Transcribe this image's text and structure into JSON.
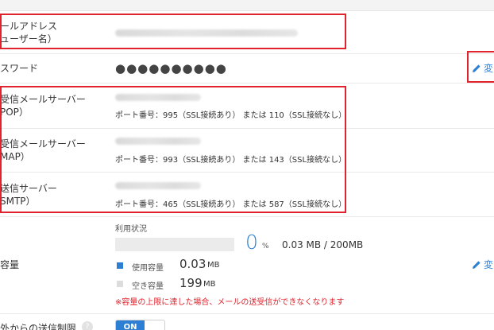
{
  "rows": {
    "email": {
      "label_line1": "ールアドレス",
      "label_line2": "ューザー名）"
    },
    "password": {
      "label": "スワード",
      "masked": "●●●●●●●●●●",
      "edit_label": "変"
    },
    "pop": {
      "label_line1": "受信メールサーバー",
      "label_line2": "POP）",
      "port_text": "ポート番号：995（SSL接続あり） または 110（SSL接続なし）"
    },
    "imap": {
      "label_line1": "受信メールサーバー",
      "label_line2": "MAP）",
      "port_text": "ポート番号：993（SSL接続あり） または 143（SSL接続なし）"
    },
    "smtp": {
      "label_line1": "送信サーバー",
      "label_line2": "SMTP）",
      "port_text": "ポート番号：465（SSL接続あり） または 587（SSL接続なし）"
    },
    "capacity": {
      "label": "容量",
      "usage_title": "利用状況",
      "percent_value": "0",
      "percent_sign": "%",
      "usage_fraction": 0,
      "usage_summary": "0.03 MB / 200MB",
      "used_label": "使用容量",
      "used_value": "0.03",
      "used_unit": "MB",
      "free_label": "空き容量",
      "free_value": "199",
      "free_unit": "MB",
      "warning": "※容量の上限に達した場合、メールの送受信ができなくなります",
      "edit_label": "変"
    },
    "send_limit": {
      "label": "外からの送信制限",
      "help_icon": "?",
      "toggle_on_label": "ON"
    }
  },
  "colors": {
    "accent": "#2d7fd3",
    "highlight": "#e0232d",
    "free": "#dcdcdc"
  }
}
